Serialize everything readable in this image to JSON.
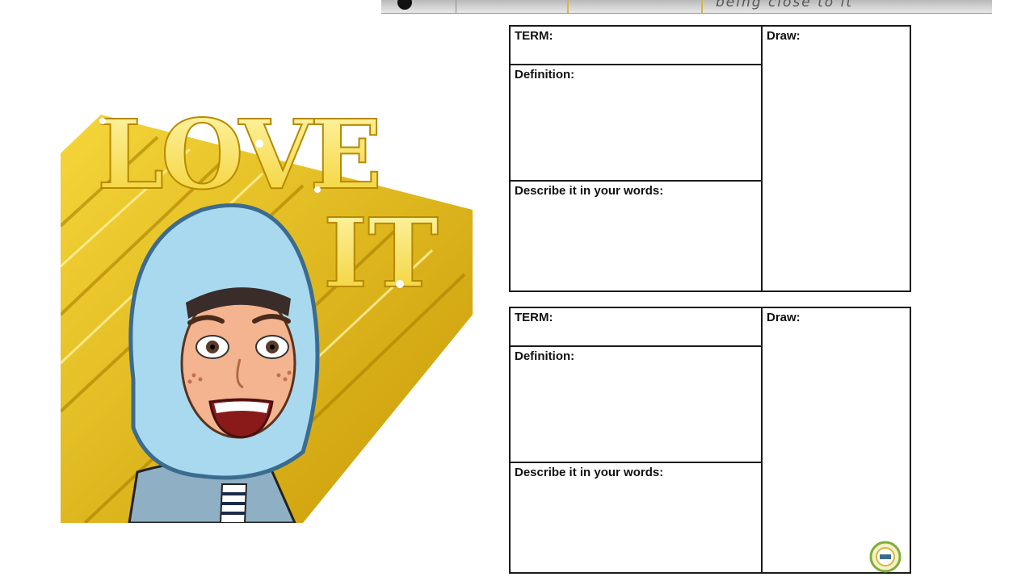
{
  "top_strip": {
    "text": "being close to it"
  },
  "sticker": {
    "line1": "LOVE",
    "line2": "IT"
  },
  "cards": [
    {
      "term_label": "TERM:",
      "definition_label": "Definition:",
      "describe_label": "Describe it in your words:",
      "draw_label": "Draw:"
    },
    {
      "term_label": "TERM:",
      "definition_label": "Definition:",
      "describe_label": "Describe it in your words:",
      "draw_label": "Draw:"
    }
  ],
  "colors": {
    "gold": "#e8c21e",
    "scarf": "#a9d9ef",
    "border": "#1a1a1a"
  }
}
